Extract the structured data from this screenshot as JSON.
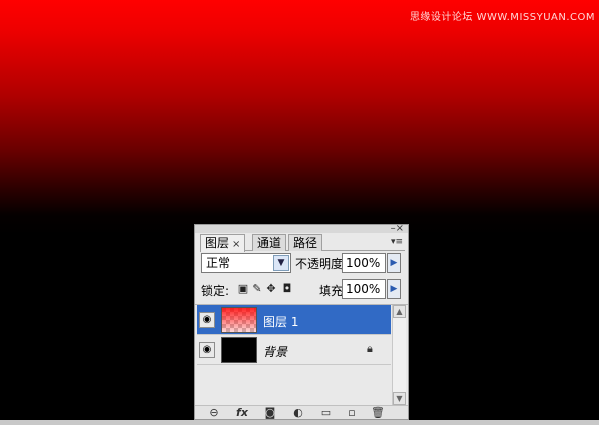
{
  "watermark": "思缘设计论坛 WWW.MISSYUAN.COM",
  "panel": {
    "tabs": [
      {
        "label": "图层",
        "close": "×"
      },
      {
        "label": "通道"
      },
      {
        "label": "路径"
      }
    ],
    "window_controls": "–×",
    "menu_icon": "▾≡",
    "blend_mode": "正常",
    "opacity_label": "不透明度:",
    "opacity_value": "100%",
    "lock_label": "锁定:",
    "fill_label": "填充:",
    "fill_value": "100%",
    "layers": [
      {
        "name": "图层 1",
        "selected": true
      },
      {
        "name": "背景",
        "selected": false,
        "locked": true
      }
    ],
    "footer_icons": [
      "link-icon",
      "fx-icon",
      "mask-icon",
      "adjustment-icon",
      "folder-icon",
      "new-layer-icon",
      "trash-icon"
    ],
    "fx_text": "fx",
    "colors": {
      "selection": "#316ac5",
      "canvas_top": "#ff0000",
      "canvas_bottom": "#000000"
    }
  }
}
